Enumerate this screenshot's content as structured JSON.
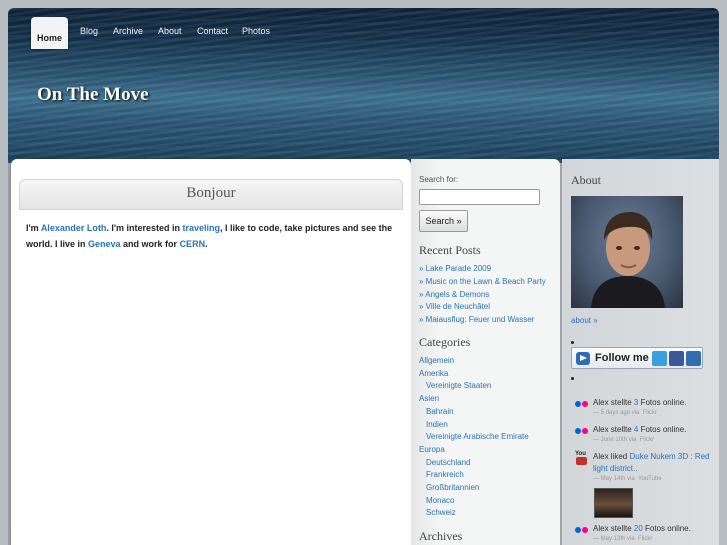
{
  "nav": {
    "items": [
      "Home",
      "Blog",
      "Archive",
      "About",
      "Contact",
      "Photos"
    ]
  },
  "site": {
    "title": "On The Move"
  },
  "post": {
    "title": "Bonjour",
    "text_1": "I'm ",
    "link_name": "Alexander Loth",
    "text_2": ". I'm interested in ",
    "link_traveling": "traveling",
    "text_3": ", I like to code, take pictures and see the world. I live in ",
    "link_city": "Geneva",
    "text_4": " and work for ",
    "link_employer": "CERN",
    "text_5": "."
  },
  "search": {
    "label": "Search for:",
    "value": "",
    "button_label": "Search »"
  },
  "recent_posts": {
    "heading": "Recent Posts",
    "items": [
      "» Lake Parade 2009",
      "» Music on the Lawn & Beach Party",
      "» Angels & Demons",
      "» Ville de Neuchâtel",
      "» Maiausflug: Feuer und Wasser"
    ]
  },
  "categories": {
    "heading": "Categories",
    "items": [
      {
        "label": "Allgemein",
        "level": 0
      },
      {
        "label": "Amerika",
        "level": 0
      },
      {
        "label": "Vereinigte Staaten",
        "level": 1
      },
      {
        "label": "Asien",
        "level": 0
      },
      {
        "label": "Bahrain",
        "level": 1
      },
      {
        "label": "Indien",
        "level": 1
      },
      {
        "label": "Vereinigte Arabische Emirate",
        "level": 1
      },
      {
        "label": "Europa",
        "level": 0
      },
      {
        "label": "Deutschland",
        "level": 1
      },
      {
        "label": "Frankreich",
        "level": 1
      },
      {
        "label": "Großbritannien",
        "level": 1
      },
      {
        "label": "Monaco",
        "level": 1
      },
      {
        "label": "Schweiz",
        "level": 1
      }
    ]
  },
  "archives": {
    "heading": "Archives"
  },
  "about": {
    "heading": "About",
    "link": "about »"
  },
  "follow": {
    "label": "Follow me"
  },
  "activity": [
    {
      "pre": "Alex stellte ",
      "count": "3",
      "post": " Fotos online.",
      "time": "— 5 days ago via",
      "source": "Flickr",
      "service": "flickr-icon"
    },
    {
      "pre": "Alex stellte ",
      "count": "4",
      "post": " Fotos online.",
      "time": "— June 10th via",
      "source": "Flickr",
      "service": "flickr-icon"
    },
    {
      "pre": "Alex liked ",
      "count": "Duke Nukem 3D : Red light district..",
      "post": "",
      "time": "— May 14th via",
      "source": "YouTube",
      "service": "youtube-icon"
    },
    {
      "pre": "Alex stellte ",
      "count": "20",
      "post": " Fotos online.",
      "time": "— May 13th via",
      "source": "Flickr",
      "service": "flickr-icon"
    }
  ],
  "colors": {
    "link": "#2a72b8",
    "flickr_blue": "#0063dc",
    "flickr_pink": "#ff0084",
    "youtube_red": "#c4302b"
  }
}
